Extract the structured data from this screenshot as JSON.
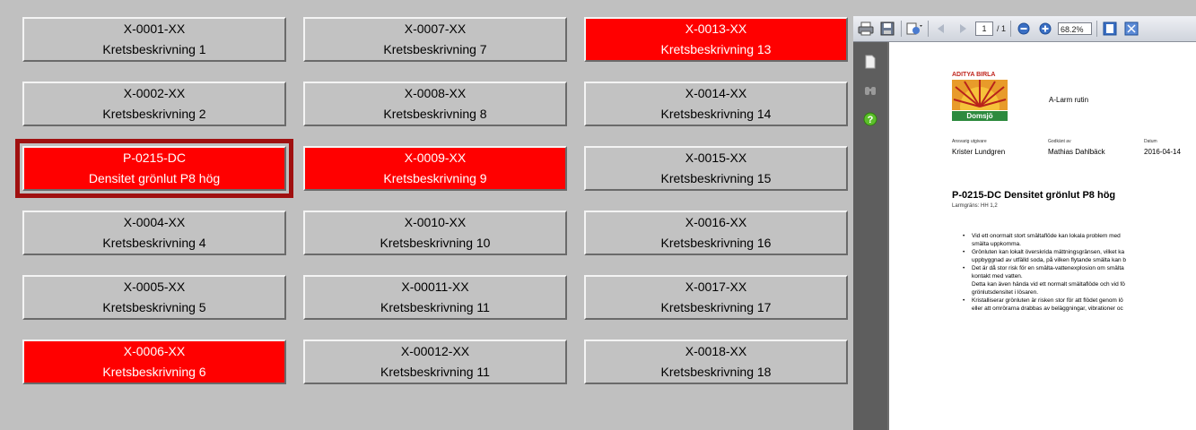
{
  "tiles": [
    {
      "code": "X-0001-XX",
      "desc": "Kretsbeskrivning 1"
    },
    {
      "code": "X-0002-XX",
      "desc": "Kretsbeskrivning 2"
    },
    {
      "code": "P-0215-DC",
      "desc": "Densitet grönlut P8 hög"
    },
    {
      "code": "X-0004-XX",
      "desc": "Kretsbeskrivning 4"
    },
    {
      "code": "X-0005-XX",
      "desc": "Kretsbeskrivning 5"
    },
    {
      "code": "X-0006-XX",
      "desc": "Kretsbeskrivning 6"
    },
    {
      "code": "X-0007-XX",
      "desc": "Kretsbeskrivning 7"
    },
    {
      "code": "X-0008-XX",
      "desc": "Kretsbeskrivning 8"
    },
    {
      "code": "X-0009-XX",
      "desc": "Kretsbeskrivning 9"
    },
    {
      "code": "X-0010-XX",
      "desc": "Kretsbeskrivning 10"
    },
    {
      "code": "X-00011-XX",
      "desc": "Kretsbeskrivning 11"
    },
    {
      "code": "X-00012-XX",
      "desc": "Kretsbeskrivning 11"
    },
    {
      "code": "X-0013-XX",
      "desc": "Kretsbeskrivning 13"
    },
    {
      "code": "X-0014-XX",
      "desc": "Kretsbeskrivning 14"
    },
    {
      "code": "X-0015-XX",
      "desc": "Kretsbeskrivning 15"
    },
    {
      "code": "X-0016-XX",
      "desc": "Kretsbeskrivning 16"
    },
    {
      "code": "X-0017-XX",
      "desc": "Kretsbeskrivning 17"
    },
    {
      "code": "X-0018-XX",
      "desc": "Kretsbeskrivning 18"
    }
  ],
  "colors": {
    "alarm": "#ff0000",
    "normal": "#c2c2c2",
    "selected_frame": "#a01010"
  },
  "viewer": {
    "page_current": "1",
    "page_total": "/ 1",
    "zoom": "68.2%",
    "toolbar_icons": [
      "print-icon",
      "save-icon",
      "export-icon",
      "prev-page-icon",
      "next-page-icon",
      "zoom-out-icon",
      "zoom-in-icon",
      "fit-page-icon",
      "fullscreen-icon"
    ],
    "nav_icons": [
      "pages-icon",
      "search-icon",
      "help-icon"
    ]
  },
  "document": {
    "logo_top": "ADITYA BIRLA",
    "logo_bottom": "Domsjö",
    "doc_title": "A-Larm rutin",
    "publisher_label": "Ansvarig utgivare",
    "publisher": "Krister Lundgren",
    "approved_label": "Godkänt av",
    "approved": "Mathias Dahlbäck",
    "date_label": "Datum",
    "date": "2016-04-14",
    "heading": "P-0215-DC Densitet grönlut P8 hög",
    "limit": "Larmgräns:  HH 1,2",
    "bullets": [
      [
        "Vid ett onormalt stort smältaflöde kan lokala problem med",
        "smälta uppkomma."
      ],
      [
        "Grönluten kan lokalt överskrida mättningsgränsen, vilket ka",
        "uppbyggnad av utfälld soda, på vilken flytande smälta kan b"
      ],
      [
        "Det är då stor risk för en smälta-vattenexplosion om smälta",
        "kontakt med vatten.",
        "Detta kan även hända vid ett normalt smältaflöde och vid fö",
        "grönlutsdensitet i lösaren."
      ],
      [
        "Kristalliserar grönluten är risken stor för att flödet genom lö",
        "eller att omrörarna drabbas av beläggningar, vibrationer oc"
      ]
    ]
  }
}
